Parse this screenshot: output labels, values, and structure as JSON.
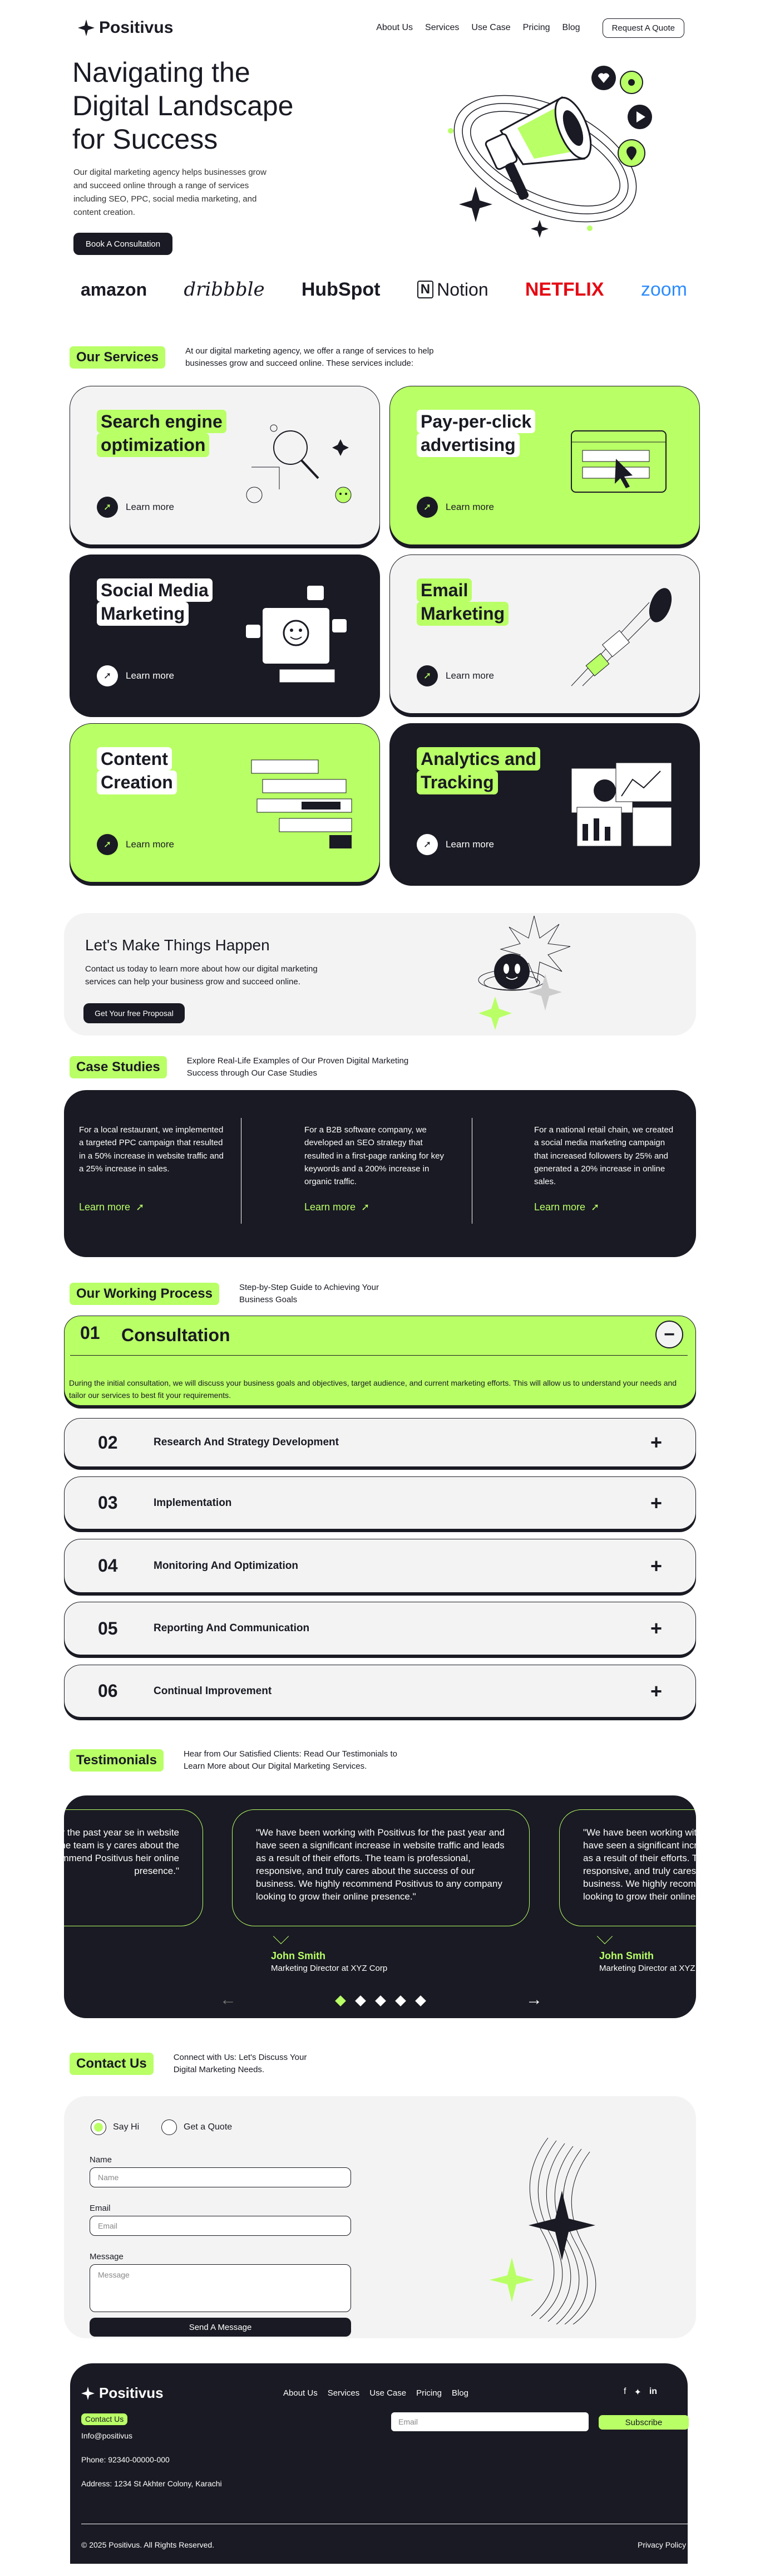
{
  "nav": {
    "brand": "Positivus",
    "links": [
      "About Us",
      "Services",
      "Use Case",
      "Pricing",
      "Blog"
    ],
    "cta": "Request A Quote"
  },
  "hero": {
    "title": "Navigating the Digital Landscape for Success",
    "body": "Our digital marketing agency helps businesses grow and succeed online through a range of services including SEO, PPC, social media marketing, and content creation.",
    "cta": "Book A Consultation"
  },
  "logos": [
    "amazon",
    "dribbble",
    "HubSpot",
    "Notion",
    "NETFLIX",
    "zoom"
  ],
  "services": {
    "tag": "Our Services",
    "desc": "At our digital marketing agency, we offer a range of services to help businesses grow and succeed online. These services include:",
    "items": [
      {
        "l1": "Search engine",
        "l2": "optimization",
        "more": "Learn more"
      },
      {
        "l1": "Pay-per-click",
        "l2": "advertising",
        "more": "Learn more"
      },
      {
        "l1": "Social Media",
        "l2": "Marketing",
        "more": "Learn more"
      },
      {
        "l1": "Email",
        "l2": "Marketing",
        "more": "Learn more"
      },
      {
        "l1": "Content",
        "l2": "Creation",
        "more": "Learn more"
      },
      {
        "l1": "Analytics and",
        "l2": "Tracking",
        "more": "Learn more"
      }
    ]
  },
  "cta_block": {
    "title": "Let's Make Things Happen",
    "body": "Contact us today to learn more about how our digital marketing services can help your business grow and succeed online.",
    "btn": "Get Your free Proposal"
  },
  "cases": {
    "tag": "Case Studies",
    "desc": "Explore Real-Life Examples of Our Proven Digital Marketing Success through Our Case Studies",
    "items": [
      {
        "text": "For a local restaurant, we implemented a targeted PPC campaign that resulted in a 50% increase in website traffic and a 25% increase in sales.",
        "link": "Learn more"
      },
      {
        "text": "For a B2B software company, we developed an SEO strategy that resulted in a first-page ranking for key keywords and a 200% increase in organic traffic.",
        "link": "Learn more"
      },
      {
        "text": "For a national retail chain, we created a social media marketing campaign that increased followers by 25% and generated a 20% increase in online sales.",
        "link": "Learn more"
      }
    ]
  },
  "process": {
    "tag": "Our Working Process",
    "desc": "Step-by-Step Guide to Achieving Your Business Goals",
    "open": {
      "num": "01",
      "title": "Consultation",
      "icon": "−",
      "body": "During the initial consultation, we will discuss your business goals and objectives, target audience, and current marketing efforts. This will allow us to understand your needs and tailor our services to best fit your requirements."
    },
    "steps": [
      {
        "num": "02",
        "title": "Research And Strategy Development",
        "icon": "+"
      },
      {
        "num": "03",
        "title": "Implementation",
        "icon": "+"
      },
      {
        "num": "04",
        "title": "Monitoring And Optimization",
        "icon": "+"
      },
      {
        "num": "05",
        "title": "Reporting And Communication",
        "icon": "+"
      },
      {
        "num": "06",
        "title": "Continual Improvement",
        "icon": "+"
      }
    ]
  },
  "testimonials": {
    "tag": "Testimonials",
    "desc": "Hear from Our Satisfied Clients: Read Our Testimonials to Learn More about Our Digital Marketing Services.",
    "quote": "\"We have been working with Positivus for the past year and have seen a significant increase in website traffic and leads as a result of their efforts. The team is professional, responsive, and truly cares about the success of our business. We highly recommend Positivus to any company looking to grow their online presence.\"",
    "left_partial": "ivus for the past year se in website traffic ts. The team is y cares about the y recommend Positivus heir online presence.\"",
    "name": "John Smith",
    "role": "Marketing Director at XYZ Corp",
    "prev": "←",
    "next": "→"
  },
  "contact": {
    "tag": "Contact Us",
    "desc": "Connect with Us: Let's Discuss Your Digital Marketing Needs.",
    "opt1": "Say Hi",
    "opt2": "Get a Quote",
    "name_label": "Name",
    "name_ph": "Name",
    "email_label": "Email",
    "email_ph": "Email",
    "msg_label": "Message",
    "msg_ph": "Message",
    "submit": "Send A Message"
  },
  "footer": {
    "brand": "Positivus",
    "links": [
      "About Us",
      "Services",
      "Use Case",
      "Pricing",
      "Blog"
    ],
    "contact_tag": "Contact Us",
    "email": "Info@positivus",
    "phone": "Phone: 92340-00000-000",
    "address": "Address: 1234 St Akhter Colony, Karachi",
    "news_ph": "Email",
    "subscribe": "Subscribe",
    "copy": "© 2025 Positivus. All Rights Reserved.",
    "privacy": "Privacy Policy"
  },
  "colors": {
    "accent": "#B9FF66",
    "dark": "#191A23",
    "grey": "#F3F3F3"
  }
}
